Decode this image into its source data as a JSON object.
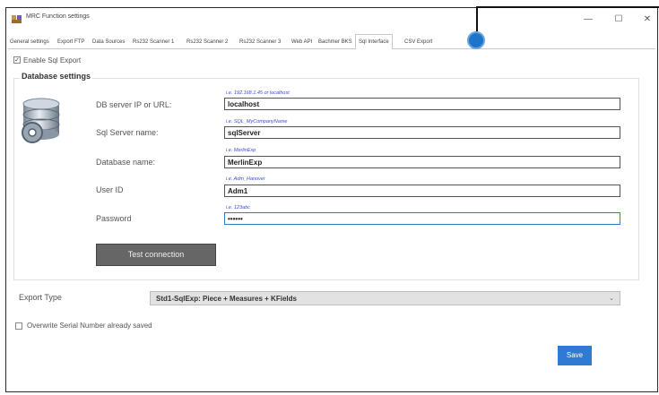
{
  "window": {
    "title": "MRC Function settings",
    "minimize": "—",
    "maximize": "☐",
    "close": "✕"
  },
  "tabs": [
    {
      "label": "General settings"
    },
    {
      "label": "Export FTP"
    },
    {
      "label": "Data Sources"
    },
    {
      "label": "Rs232 Scanner 1"
    },
    {
      "label": "Rs232 Scanner 2"
    },
    {
      "label": "Rs232 Scanner 3"
    },
    {
      "label": "Web API"
    },
    {
      "label": "Bachmer BKS"
    },
    {
      "label": "Sql Interface",
      "active": true
    },
    {
      "label": "CSV Export"
    }
  ],
  "enable_sql": {
    "label": "Enable Sql Export",
    "checked": true
  },
  "database_settings": {
    "title": "Database settings",
    "fields": [
      {
        "label": "DB server IP or URL:",
        "hint": "i.e. 192.168.1.45 or localhost",
        "value": "localhost"
      },
      {
        "label": "Sql Server name:",
        "hint": "i.e. SQL_MyCompanyName",
        "value": "sqlServer"
      },
      {
        "label": "Database name:",
        "hint": "i.e. MerlinExp",
        "value": "MerlinExp"
      },
      {
        "label": "User ID",
        "hint": "i.e. Adm_Hanover",
        "value": "Adm1"
      },
      {
        "label": "Password",
        "hint": "i.e. 123abc",
        "value": "••••••"
      }
    ],
    "test_button": "Test connection"
  },
  "export_type": {
    "label": "Export Type",
    "selected": "Std1-SqlExp: Piece + Measures + KFields"
  },
  "overwrite": {
    "label": "Overwrite Serial Number already saved",
    "checked": false
  },
  "save_button": "Save",
  "colors": {
    "accent": "#2f7bd3",
    "callout": "#1d75c9",
    "hint_text": "#3a4fd0",
    "test_button": "#666666"
  },
  "icons": {
    "app": "app-icon",
    "database": "database-gear-icon",
    "dropdown": "chevron-down-icon"
  }
}
